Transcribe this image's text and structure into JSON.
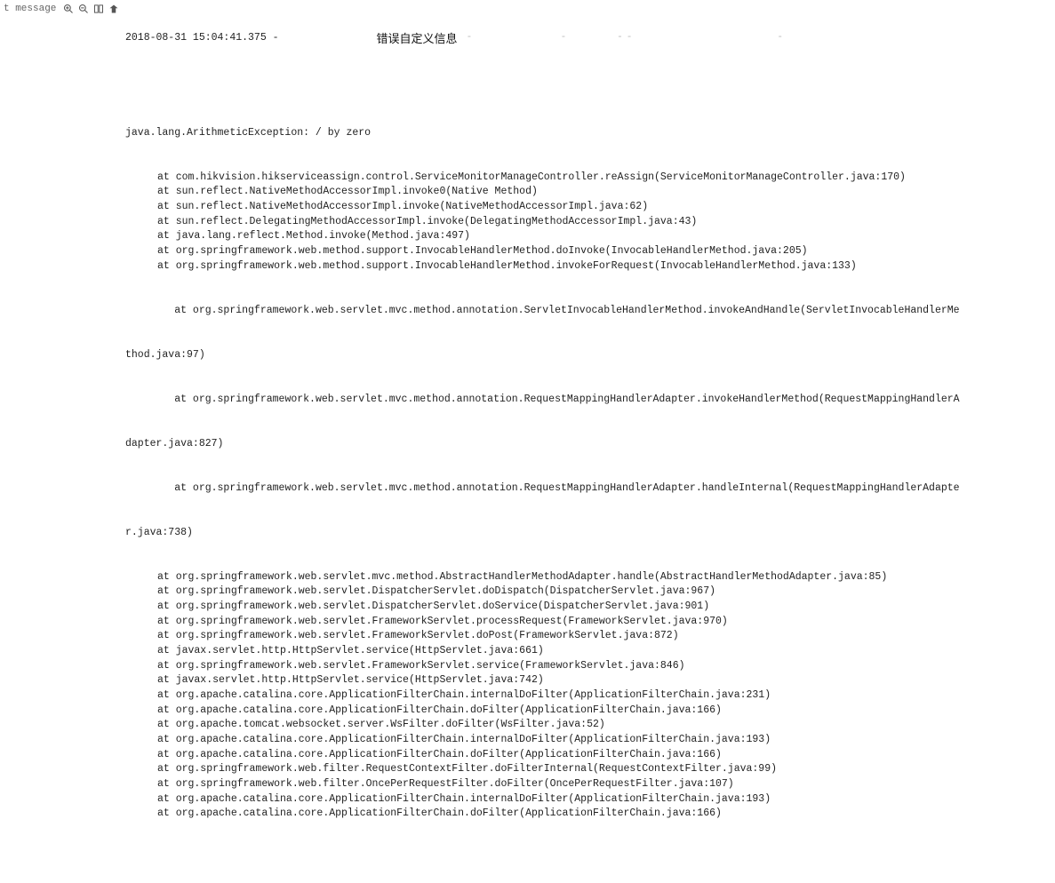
{
  "row_label": "t  message",
  "timestamp": "2018-08-31 15:04:41.375",
  "header_mark": "-",
  "note": "错误自定义信息",
  "faint_marks": "-         -     --               -",
  "exception_line": "java.lang.ArithmeticException: / by zero",
  "stack": [
    "at com.hikvision.hikserviceassign.control.ServiceMonitorManageController.reAssign(ServiceMonitorManageController.java:170)",
    "at sun.reflect.NativeMethodAccessorImpl.invoke0(Native Method)",
    "at sun.reflect.NativeMethodAccessorImpl.invoke(NativeMethodAccessorImpl.java:62)",
    "at sun.reflect.DelegatingMethodAccessorImpl.invoke(DelegatingMethodAccessorImpl.java:43)",
    "at java.lang.reflect.Method.invoke(Method.java:497)",
    "at org.springframework.web.method.support.InvocableHandlerMethod.doInvoke(InvocableHandlerMethod.java:205)",
    "at org.springframework.web.method.support.InvocableHandlerMethod.invokeForRequest(InvocableHandlerMethod.java:133)"
  ],
  "wrap1_a": "        at org.springframework.web.servlet.mvc.method.annotation.ServletInvocableHandlerMethod.invokeAndHandle(ServletInvocableHandlerMe",
  "wrap1_b": "thod.java:97)",
  "wrap2_a": "        at org.springframework.web.servlet.mvc.method.annotation.RequestMappingHandlerAdapter.invokeHandlerMethod(RequestMappingHandlerA",
  "wrap2_b": "dapter.java:827)",
  "wrap3_a": "        at org.springframework.web.servlet.mvc.method.annotation.RequestMappingHandlerAdapter.handleInternal(RequestMappingHandlerAdapte",
  "wrap3_b": "r.java:738)",
  "stack2": [
    "at org.springframework.web.servlet.mvc.method.AbstractHandlerMethodAdapter.handle(AbstractHandlerMethodAdapter.java:85)",
    "at org.springframework.web.servlet.DispatcherServlet.doDispatch(DispatcherServlet.java:967)",
    "at org.springframework.web.servlet.DispatcherServlet.doService(DispatcherServlet.java:901)",
    "at org.springframework.web.servlet.FrameworkServlet.processRequest(FrameworkServlet.java:970)",
    "at org.springframework.web.servlet.FrameworkServlet.doPost(FrameworkServlet.java:872)",
    "at javax.servlet.http.HttpServlet.service(HttpServlet.java:661)",
    "at org.springframework.web.servlet.FrameworkServlet.service(FrameworkServlet.java:846)",
    "at javax.servlet.http.HttpServlet.service(HttpServlet.java:742)",
    "at org.apache.catalina.core.ApplicationFilterChain.internalDoFilter(ApplicationFilterChain.java:231)",
    "at org.apache.catalina.core.ApplicationFilterChain.doFilter(ApplicationFilterChain.java:166)",
    "at org.apache.tomcat.websocket.server.WsFilter.doFilter(WsFilter.java:52)",
    "at org.apache.catalina.core.ApplicationFilterChain.internalDoFilter(ApplicationFilterChain.java:193)",
    "at org.apache.catalina.core.ApplicationFilterChain.doFilter(ApplicationFilterChain.java:166)",
    "at org.springframework.web.filter.RequestContextFilter.doFilterInternal(RequestContextFilter.java:99)",
    "at org.springframework.web.filter.OncePerRequestFilter.doFilter(OncePerRequestFilter.java:107)",
    "at org.apache.catalina.core.ApplicationFilterChain.internalDoFilter(ApplicationFilterChain.java:193)",
    "at org.apache.catalina.core.ApplicationFilterChain.doFilter(ApplicationFilterChain.java:166)"
  ]
}
